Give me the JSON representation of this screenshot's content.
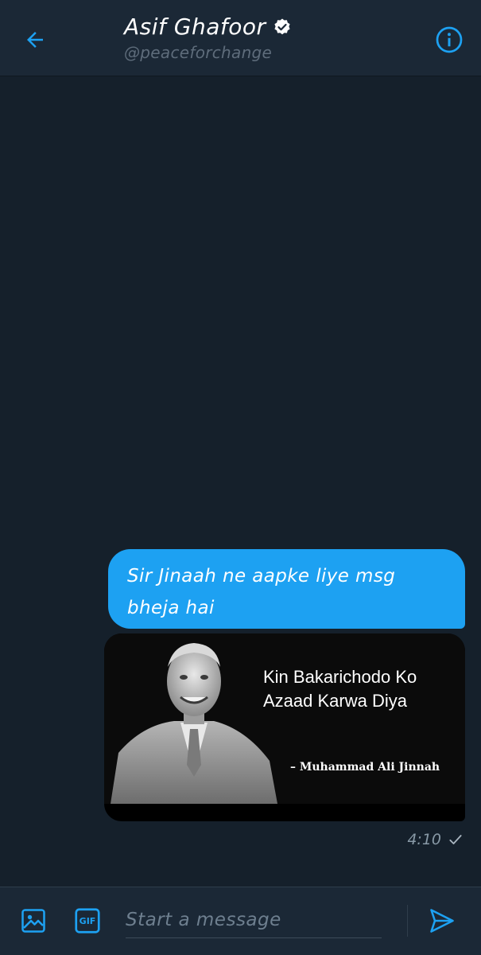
{
  "header": {
    "title": "Asif Ghafoor",
    "handle": "@peaceforchange",
    "back_icon": "arrow-left-icon",
    "verified_icon": "verified-badge-icon",
    "info_icon": "info-icon"
  },
  "message": {
    "text": "Sir Jinaah ne aapke liye msg bheja hai",
    "time": "4:10",
    "status_icon": "check-icon"
  },
  "media": {
    "quote_line1": "Kin Bakarichodo Ko",
    "quote_line2": "Azaad Karwa Diya",
    "author": "– Muhammad Ali Jinnah"
  },
  "composer": {
    "placeholder": "Start a message",
    "image_icon": "image-icon",
    "gif_label": "GIF",
    "send_icon": "send-icon"
  },
  "colors": {
    "background": "#15202b",
    "header": "#1b2836",
    "accent": "#1da1f2",
    "muted": "#8899a6"
  }
}
